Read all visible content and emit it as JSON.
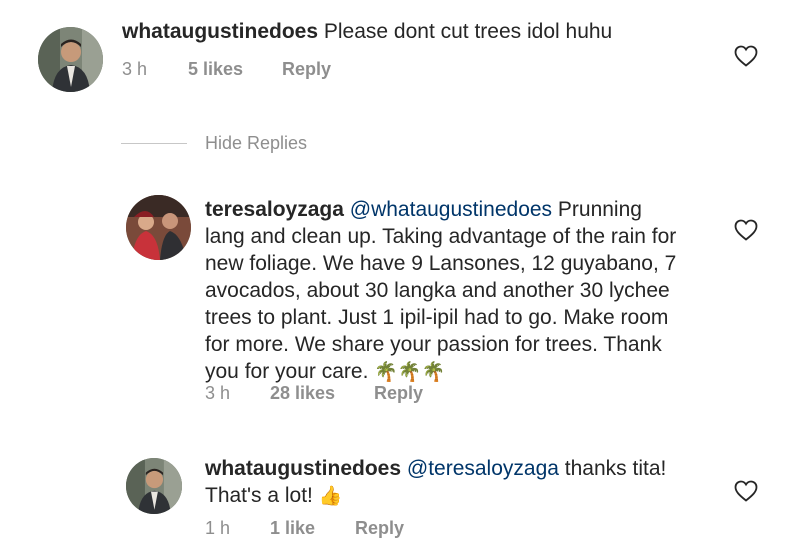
{
  "comments": [
    {
      "username": "whataugustinedoes",
      "text": " Please dont cut trees idol huhu",
      "time": "3 h",
      "likes": "5 likes",
      "reply": "Reply"
    }
  ],
  "hide_replies": "Hide Replies",
  "replies": [
    {
      "username": "teresaloyzaga",
      "mention": "@whataugustinedoes",
      "lines": [
        " Prunning",
        "lang and clean up. Taking advantage of the rain for",
        "new foliage. We have 9 Lansones, 12 guyabano, 7",
        "avocados, about 30 langka and another 30 lychee",
        "trees to plant. Just 1 ipil-ipil had to go. Make room",
        "for more. We share your passion for trees. Thank",
        "you for your care. "
      ],
      "emoji": "🌴🌴🌴",
      "time": "3 h",
      "likes": "28 likes",
      "reply": "Reply"
    },
    {
      "username": "whataugustinedoes",
      "mention": "@teresaloyzaga",
      "lines": [
        " thanks tita!",
        "That's a lot! "
      ],
      "emoji": "👍",
      "time": "1 h",
      "likes": "1 like",
      "reply": "Reply"
    }
  ],
  "colors": {
    "text": "#262626",
    "meta": "#8e8e8e",
    "mention": "#003569"
  },
  "icons": [
    "heart-outline-icon",
    "avatar"
  ]
}
